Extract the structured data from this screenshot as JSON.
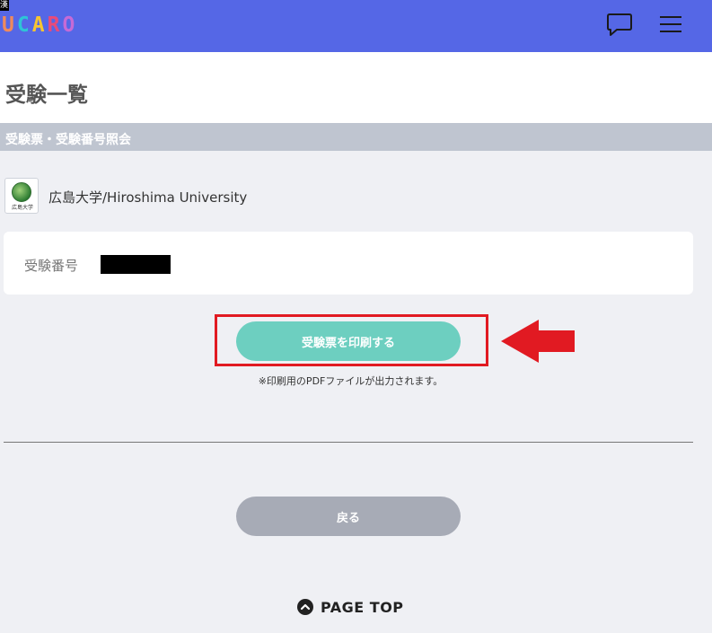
{
  "header": {
    "corner_tag": "漢",
    "logo_letters": [
      {
        "char": "U",
        "color": "#f08a5d"
      },
      {
        "char": "C",
        "color": "#2ec4d6"
      },
      {
        "char": "A",
        "color": "#f7c531"
      },
      {
        "char": "R",
        "color": "#e84b7a"
      },
      {
        "char": "O",
        "color": "#c56ad6"
      }
    ],
    "background": "#5567e6"
  },
  "page_title": "受験一覧",
  "section_title": "受験票・受験番号照会",
  "university": {
    "logo_caption": "広島大学",
    "name": "広島大学/Hiroshima University"
  },
  "exam": {
    "label": "受験番号",
    "value_redacted": true
  },
  "actions": {
    "print_label": "受験票を印刷する",
    "print_note": "※印刷用のPDFファイルが出力されます。",
    "back_label": "戻る"
  },
  "footer": {
    "page_top_label": "PAGE TOP"
  },
  "colors": {
    "print_button": "#6dcfc0",
    "back_button": "#a7abb6",
    "highlight": "#e11a22",
    "section_bar": "#bfc5d0"
  }
}
